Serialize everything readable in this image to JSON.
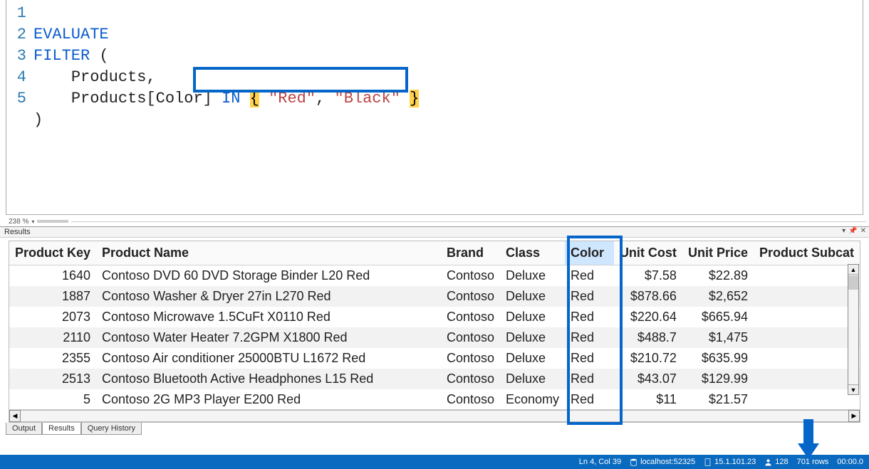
{
  "editor": {
    "lines": [
      "1",
      "2",
      "3",
      "4",
      "5"
    ],
    "tok": {
      "evaluate": "EVALUATE",
      "filter": "FILTER",
      "open": "(",
      "products": "Products",
      "comma": ",",
      "productsCol": "Products[Color]",
      "in": "IN",
      "lbrace": "{",
      "str1": "\"Red\"",
      "sep": ",",
      "str2": "\"Black\"",
      "rbrace": "}",
      "close": ")"
    },
    "zoom": "238 %"
  },
  "results": {
    "panel_label": "Results",
    "columns": [
      {
        "key": "product_key",
        "label": "Product Key",
        "align": "num"
      },
      {
        "key": "product_name",
        "label": "Product Name",
        "align": ""
      },
      {
        "key": "brand",
        "label": "Brand",
        "align": ""
      },
      {
        "key": "class",
        "label": "Class",
        "align": ""
      },
      {
        "key": "color",
        "label": "Color",
        "align": "",
        "sorted": true
      },
      {
        "key": "unit_cost",
        "label": "Unit Cost",
        "align": "num"
      },
      {
        "key": "unit_price",
        "label": "Unit Price",
        "align": "num"
      },
      {
        "key": "product_subcat",
        "label": "Product Subcat",
        "align": ""
      }
    ],
    "rows": [
      {
        "product_key": "1640",
        "product_name": "Contoso DVD 60 DVD Storage Binder L20 Red",
        "brand": "Contoso",
        "class": "Deluxe",
        "color": "Red",
        "unit_cost": "$7.58",
        "unit_price": "$22.89",
        "product_subcat": ""
      },
      {
        "product_key": "1887",
        "product_name": "Contoso Washer & Dryer 27in L270 Red",
        "brand": "Contoso",
        "class": "Deluxe",
        "color": "Red",
        "unit_cost": "$878.66",
        "unit_price": "$2,652",
        "product_subcat": ""
      },
      {
        "product_key": "2073",
        "product_name": "Contoso Microwave 1.5CuFt X0110 Red",
        "brand": "Contoso",
        "class": "Deluxe",
        "color": "Red",
        "unit_cost": "$220.64",
        "unit_price": "$665.94",
        "product_subcat": ""
      },
      {
        "product_key": "2110",
        "product_name": "Contoso Water Heater 7.2GPM X1800 Red",
        "brand": "Contoso",
        "class": "Deluxe",
        "color": "Red",
        "unit_cost": "$488.7",
        "unit_price": "$1,475",
        "product_subcat": ""
      },
      {
        "product_key": "2355",
        "product_name": "Contoso Air conditioner 25000BTU L1672 Red",
        "brand": "Contoso",
        "class": "Deluxe",
        "color": "Red",
        "unit_cost": "$210.72",
        "unit_price": "$635.99",
        "product_subcat": ""
      },
      {
        "product_key": "2513",
        "product_name": "Contoso Bluetooth Active Headphones L15 Red",
        "brand": "Contoso",
        "class": "Deluxe",
        "color": "Red",
        "unit_cost": "$43.07",
        "unit_price": "$129.99",
        "product_subcat": ""
      },
      {
        "product_key": "5",
        "product_name": "Contoso 2G MP3 Player E200 Red",
        "brand": "Contoso",
        "class": "Economy",
        "color": "Red",
        "unit_cost": "$11",
        "unit_price": "$21.57",
        "product_subcat": ""
      }
    ]
  },
  "tabs": {
    "output": "Output",
    "results": "Results",
    "history": "Query History"
  },
  "status": {
    "cursor": "Ln 4, Col 39",
    "server": "localhost:52325",
    "version": "15.1.101.23",
    "users": "128",
    "rows": "701 rows",
    "time": "00:00.0"
  }
}
